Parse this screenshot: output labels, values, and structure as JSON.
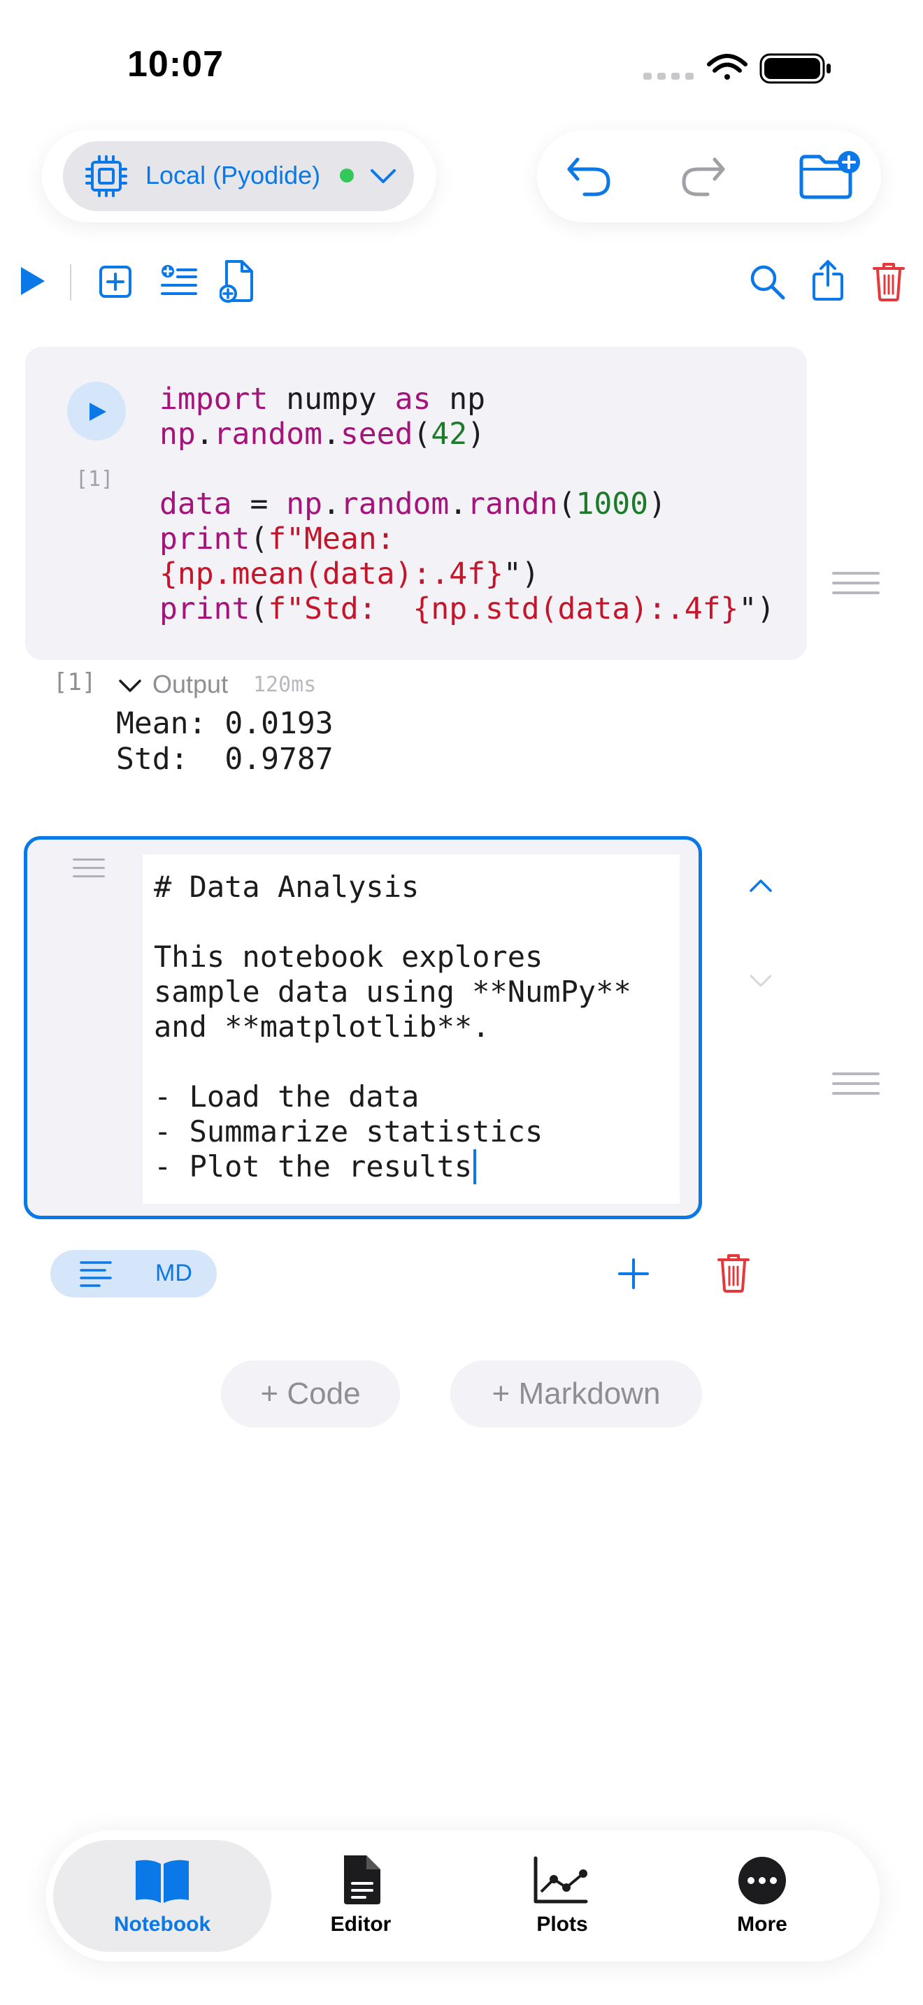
{
  "status_bar": {
    "time": "10:07"
  },
  "kernel": {
    "label": "Local (Pyodide)",
    "status_color": "#34c759"
  },
  "colors": {
    "accent": "#0a78e6",
    "danger": "#e5383b",
    "success": "#34c759"
  },
  "toolbar": {
    "icons": [
      "run-all-icon",
      "add-cell-icon",
      "add-markdown-list-icon",
      "add-file-icon",
      "search-icon",
      "share-icon",
      "trash-icon"
    ]
  },
  "code_cell": {
    "exec_count": "[1]",
    "lines": [
      "import numpy as np",
      "np.random.seed(42)",
      "",
      "data = np.random.randn(1000)",
      "print(f\"Mean:",
      "{np.mean(data):.4f}\")",
      "print(f\"Std:  {np.std(data):.4f}\")"
    ]
  },
  "output": {
    "exec_count": "[1]",
    "label": "Output",
    "duration": "120ms",
    "text": "Mean: 0.0193\nStd:  0.9787"
  },
  "markdown_cell": {
    "source": "# Data Analysis\n\nThis notebook explores\nsample data using **NumPy**\nand **matplotlib**.\n\n- Load the data\n- Summarize statistics\n- Plot the results",
    "type_label": "MD"
  },
  "add_buttons": {
    "code": "+ Code",
    "markdown": "+ Markdown"
  },
  "tabs": [
    {
      "label": "Notebook",
      "icon": "book-icon",
      "active": true
    },
    {
      "label": "Editor",
      "icon": "document-icon",
      "active": false
    },
    {
      "label": "Plots",
      "icon": "chart-icon",
      "active": false
    },
    {
      "label": "More",
      "icon": "more-icon",
      "active": false
    }
  ]
}
